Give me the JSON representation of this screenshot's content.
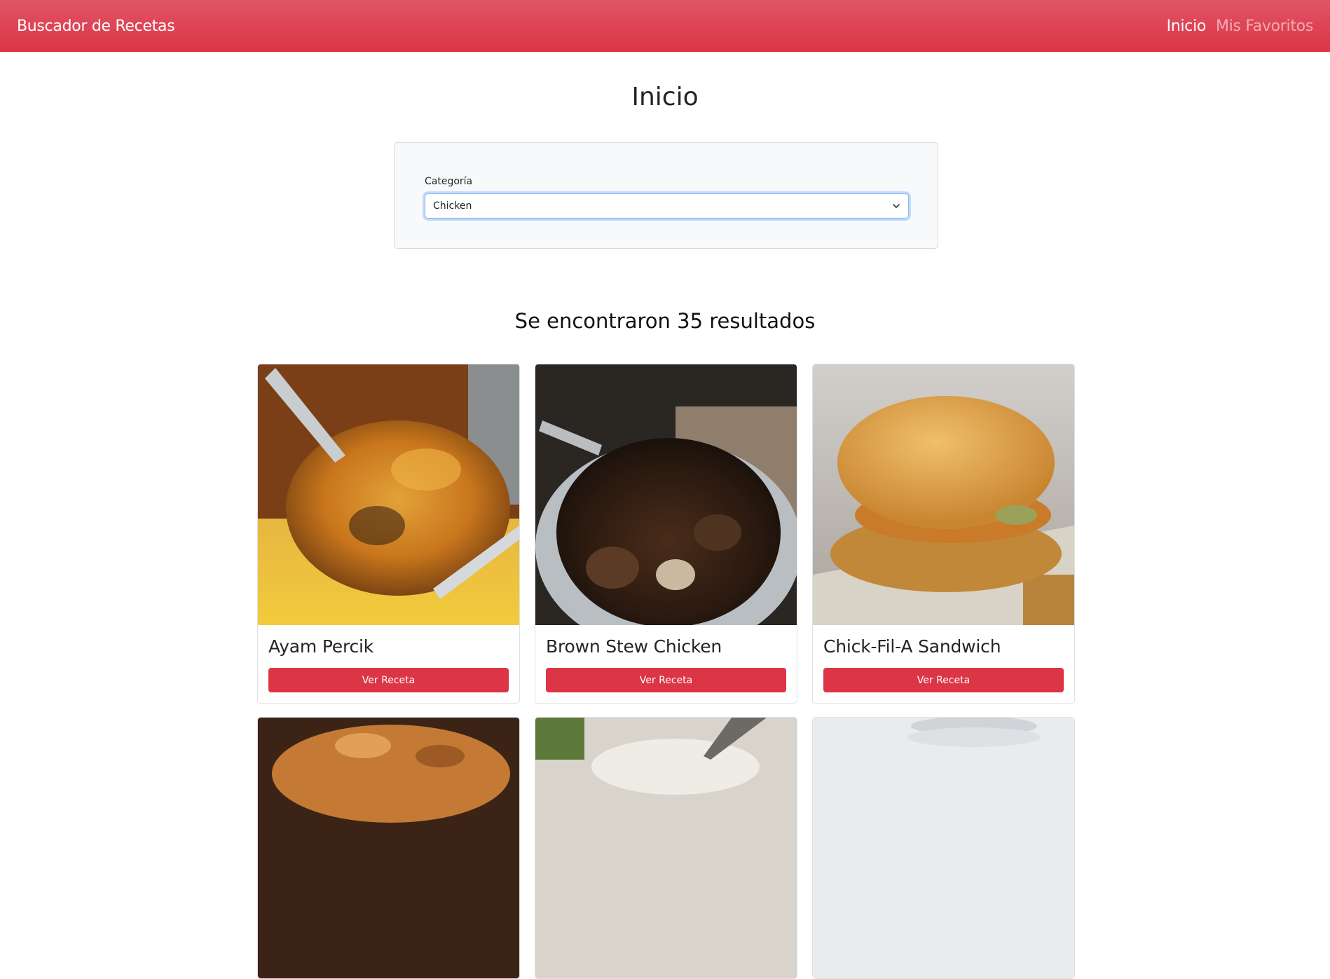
{
  "navbar": {
    "brand": "Buscador de Recetas",
    "links": [
      {
        "label": "Inicio",
        "active": true
      },
      {
        "label": "Mis Favoritos",
        "active": false
      }
    ],
    "accent_color": "#dc3545"
  },
  "page": {
    "title": "Inicio"
  },
  "filter": {
    "label": "Categoría",
    "selected": "Chicken",
    "icon": "chevron-down-icon"
  },
  "results": {
    "heading": "Se encontraron 35 resultados",
    "cards": [
      {
        "title": "Ayam Percik",
        "button": "Ver Receta"
      },
      {
        "title": "Brown Stew Chicken",
        "button": "Ver Receta"
      },
      {
        "title": "Chick-Fil-A Sandwich",
        "button": "Ver Receta"
      },
      {
        "title": "",
        "button": ""
      },
      {
        "title": "",
        "button": ""
      },
      {
        "title": "",
        "button": ""
      }
    ]
  }
}
